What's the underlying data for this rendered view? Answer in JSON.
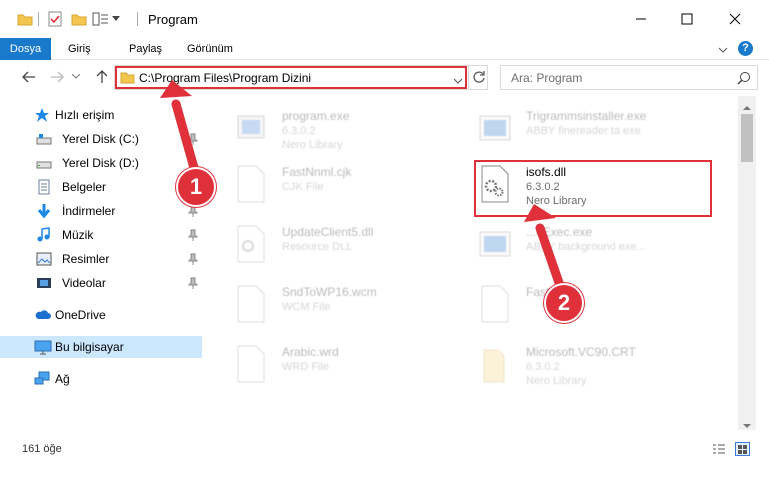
{
  "window": {
    "title": "Program",
    "minimize_icon": "minimize-icon",
    "maximize_icon": "maximize-icon",
    "close_icon": "close-icon"
  },
  "ribbon": {
    "tabs": [
      "Dosya",
      "Giriş",
      "Paylaş",
      "Görünüm"
    ],
    "active_tab": "Dosya",
    "accent": "#1979ca"
  },
  "address": {
    "path": "C:\\Program Files\\Program Dizini",
    "search_placeholder": "Ara: Program"
  },
  "sidebar": {
    "items": [
      {
        "label": "Hızlı erişim",
        "icon": "star-icon"
      },
      {
        "label": "Yerel Disk (C:)",
        "icon": "drive-icon"
      },
      {
        "label": "Yerel Disk (D:)",
        "icon": "drive-icon"
      },
      {
        "label": "Belgeler",
        "icon": "documents-icon"
      },
      {
        "label": "İndirmeler",
        "icon": "download-icon"
      },
      {
        "label": "Müzik",
        "icon": "music-icon"
      },
      {
        "label": "Resimler",
        "icon": "pictures-icon"
      },
      {
        "label": "Videolar",
        "icon": "videos-icon"
      },
      {
        "label": "OneDrive",
        "icon": "cloud-icon"
      },
      {
        "label": "Bu bilgisayar",
        "icon": "computer-icon"
      },
      {
        "label": "Ağ",
        "icon": "network-icon"
      }
    ],
    "selected": "Bu bilgisayar"
  },
  "files": [
    {
      "name": "program.exe",
      "line2": "6.3.0.2",
      "line3": "Nero Library"
    },
    {
      "name": "Trigrammsinstaller.exe",
      "line2": "ABBY finereader ta exe",
      "line3": ""
    },
    {
      "name": "FastNnml.cjk",
      "line2": "CJK File",
      "line3": ""
    },
    {
      "name": "isofs.dll",
      "line2": "6.3.0.2",
      "line3": "Nero Library"
    },
    {
      "name": "UpdateClient5.dll",
      "line2": "Resource DLL",
      "line3": ""
    },
    {
      "name": "...eExec.exe",
      "line2": "ABBY background exe...",
      "line3": ""
    },
    {
      "name": "SndToWP16.wcm",
      "line2": "WCM File",
      "line3": ""
    },
    {
      "name": "Fast...cjk",
      "line2": "",
      "line3": ""
    },
    {
      "name": "Arabic.wrd",
      "line2": "WRD File",
      "line3": ""
    },
    {
      "name": "Microsoft.VC90.CRT",
      "line2": "6.3.0.2",
      "line3": "Nero Library"
    }
  ],
  "annotations": {
    "step1": "1",
    "step2": "2",
    "color": "#e0303a"
  },
  "status": {
    "item_count": "161 öğe"
  }
}
